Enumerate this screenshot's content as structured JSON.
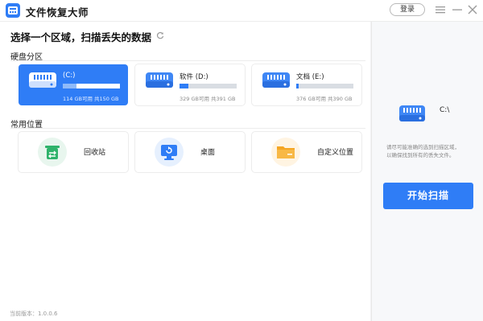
{
  "app": {
    "title": "文件恢复大师",
    "login_label": "登录",
    "version_text": "当前版本：1.0.0.6",
    "logo_icon": "app-logo-icon",
    "accent_color": "#2f7df6"
  },
  "window_controls": [
    "menu-icon",
    "minimize-icon",
    "close-icon"
  ],
  "main": {
    "heading": "选择一个区域，扫描丢失的数据",
    "refresh_icon": "refresh-icon",
    "drives_section_label": "硬盘分区",
    "drives": [
      {
        "name": "(C:)",
        "size_text": "114 GB可用 共150 GB",
        "used_fraction": 0.24,
        "selected": true,
        "icon": "hard-drive-icon"
      },
      {
        "name": "软件 (D:)",
        "size_text": "329 GB可用 共391 GB",
        "used_fraction": 0.16,
        "selected": false,
        "icon": "hard-drive-icon"
      },
      {
        "name": "文档 (E:)",
        "size_text": "376 GB可用 共390 GB",
        "used_fraction": 0.04,
        "selected": false,
        "icon": "hard-drive-icon"
      }
    ],
    "locations_section_label": "常用位置",
    "locations": [
      {
        "label": "回收站",
        "icon": "recycle-bin-icon"
      },
      {
        "label": "桌面",
        "icon": "desktop-icon"
      },
      {
        "label": "自定义位置",
        "icon": "folder-icon"
      }
    ]
  },
  "side": {
    "drive_label": "C:\\",
    "hint_lines": [
      "请尽可能准确的选到扫描区域，",
      "以确保找到所有的丢失文件。"
    ],
    "scan_button_label": "开始扫描"
  }
}
